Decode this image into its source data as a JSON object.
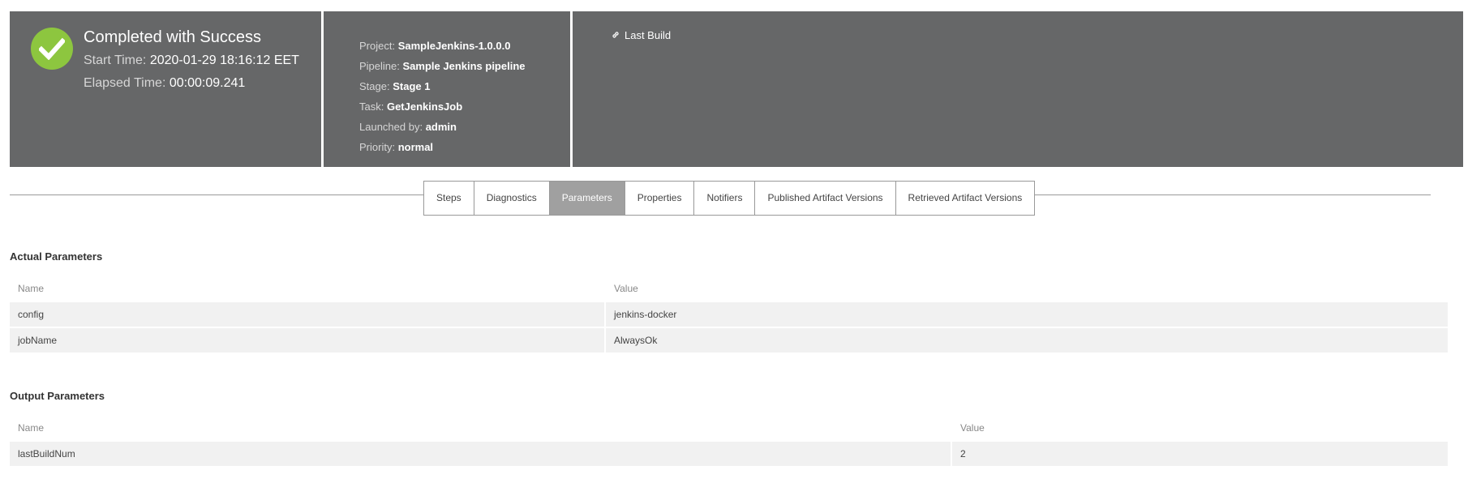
{
  "header": {
    "status_title": "Completed with Success",
    "start_time_label": "Start Time:",
    "start_time_value": "2020-01-29 18:16:12 EET",
    "elapsed_time_label": "Elapsed Time:",
    "elapsed_time_value": "00:00:09.241",
    "details": [
      {
        "label": "Project:",
        "value": "SampleJenkins-1.0.0.0"
      },
      {
        "label": "Pipeline:",
        "value": "Sample Jenkins pipeline"
      },
      {
        "label": "Stage:",
        "value": "Stage 1"
      },
      {
        "label": "Task:",
        "value": "GetJenkinsJob"
      },
      {
        "label": "Launched by:",
        "value": "admin"
      },
      {
        "label": "Priority:",
        "value": "normal"
      }
    ],
    "link_label": "Last Build",
    "status_icon": "check-circle-icon",
    "link_icon": "link-icon"
  },
  "tabs": [
    {
      "label": "Steps"
    },
    {
      "label": "Diagnostics"
    },
    {
      "label": "Parameters",
      "active": true
    },
    {
      "label": "Properties"
    },
    {
      "label": "Notifiers"
    },
    {
      "label": "Published Artifact Versions"
    },
    {
      "label": "Retrieved Artifact Versions"
    }
  ],
  "actual_parameters": {
    "title": "Actual Parameters",
    "columns": [
      "Name",
      "Value"
    ],
    "rows": [
      [
        "config",
        "jenkins-docker"
      ],
      [
        "jobName",
        "AlwaysOk"
      ]
    ]
  },
  "output_parameters": {
    "title": "Output Parameters",
    "columns": [
      "Name",
      "Value"
    ],
    "rows": [
      [
        "lastBuildNum",
        "2"
      ]
    ]
  },
  "colors": {
    "header_bg": "#666768",
    "success_green": "#8dc63f",
    "active_tab_bg": "#a0a0a0",
    "row_bg": "#f1f1f1"
  }
}
